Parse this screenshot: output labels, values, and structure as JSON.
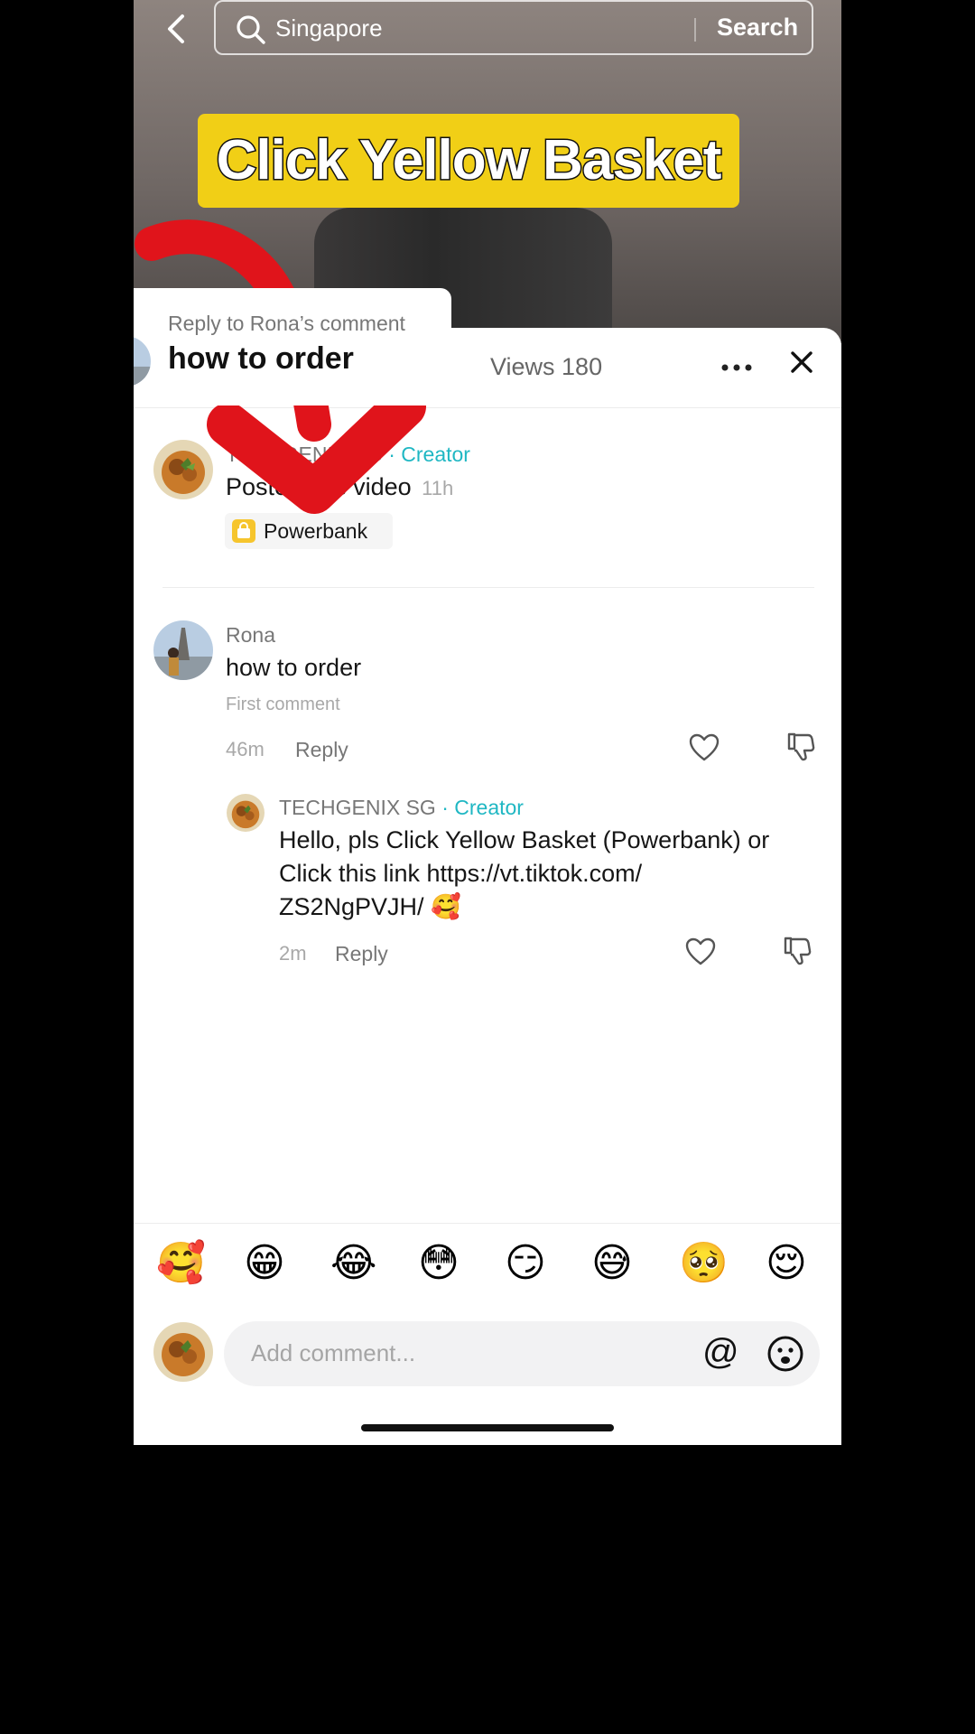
{
  "search": {
    "query": "Singapore",
    "button_label": "Search"
  },
  "video": {
    "banner_text": "Click Yellow Basket"
  },
  "reply_popup": {
    "title": "Reply to Rona’s comment",
    "text": "how to order"
  },
  "sheet": {
    "views_label": "Views 180"
  },
  "post": {
    "author": "TECHGENIX SG",
    "badge": "· Creator",
    "text": "Posted this video",
    "time": "11h",
    "product_label": "Powerbank"
  },
  "comments": [
    {
      "author": "Rona",
      "text": "how to order",
      "tag": "First comment",
      "time": "46m",
      "reply_label": "Reply"
    },
    {
      "author": "TECHGENIX SG",
      "badge": "· Creator",
      "text_line1": "Hello, pls Click Yellow Basket (Powerbank) or",
      "text_line2": "Click this link https://vt.tiktok.com/",
      "text_line3": "ZS2NgPVJH/ 🥰",
      "time": "2m",
      "reply_label": "Reply"
    }
  ],
  "emojis": [
    "🥰",
    "😁",
    "😂",
    "😳",
    "😏",
    "😅",
    "🥺",
    "😌"
  ],
  "composer": {
    "placeholder": "Add comment...",
    "at_symbol": "@"
  },
  "colors": {
    "creator": "#1fb7c3",
    "banner": "#f1cf16",
    "arrow": "#e0141b"
  }
}
